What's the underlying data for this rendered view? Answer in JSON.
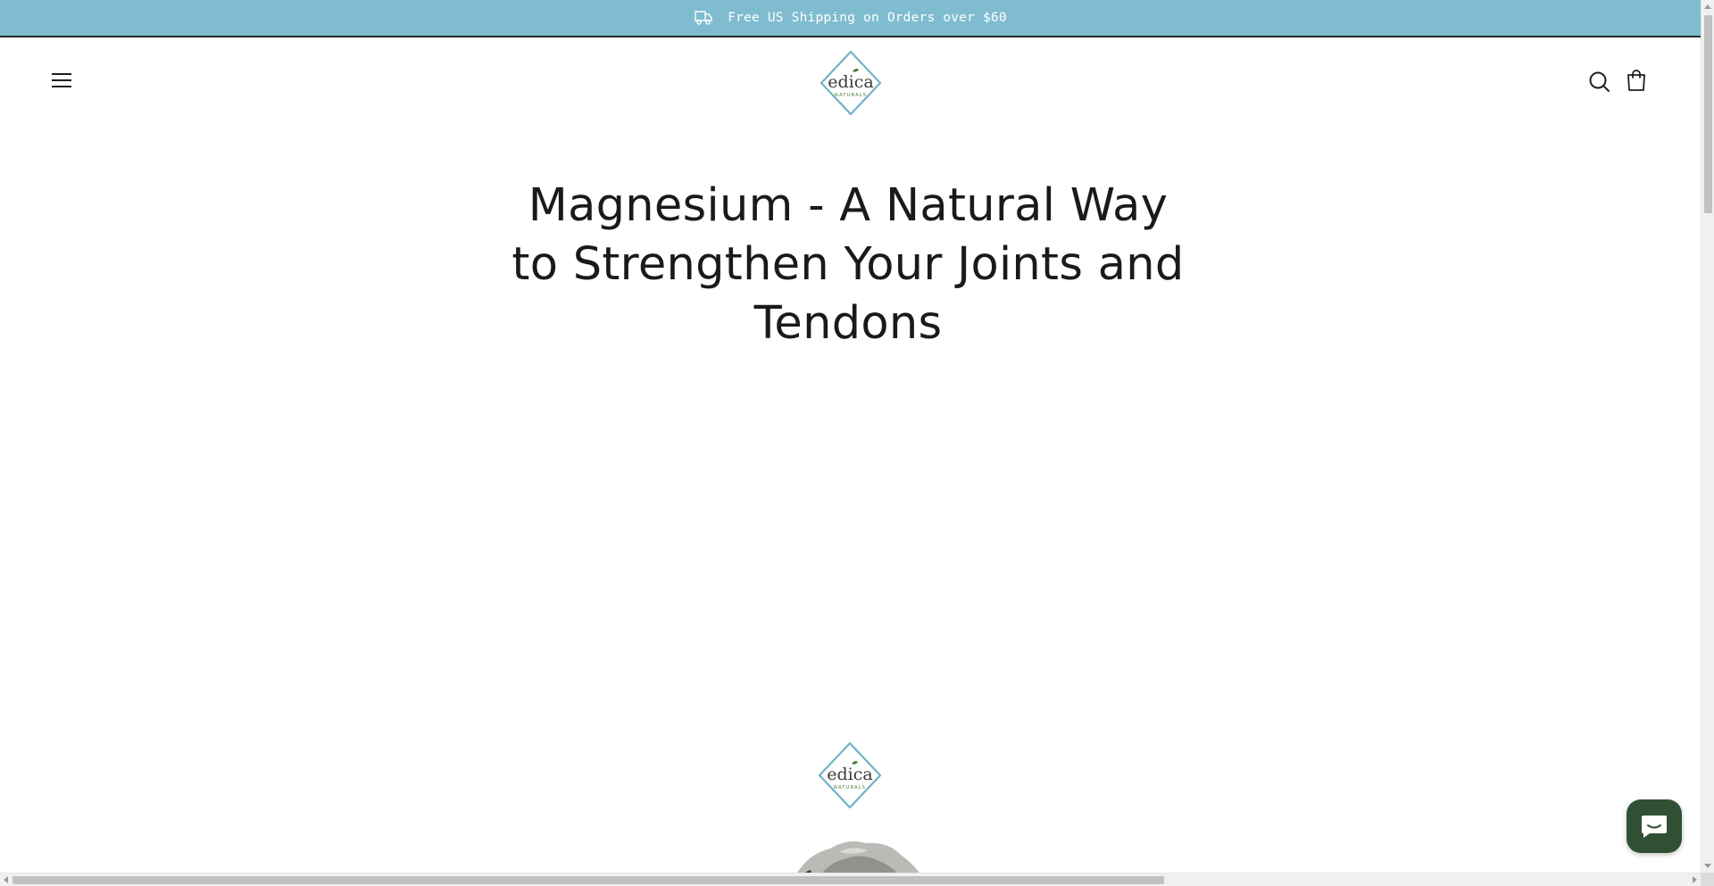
{
  "announcement": {
    "icon": "truck-icon",
    "text": "Free US Shipping on Orders over $60",
    "background": "#7fbccf"
  },
  "header": {
    "menu_icon": "hamburger-menu-icon",
    "logo": {
      "name": "edica",
      "tagline": "NATURALS"
    },
    "search_icon": "search-icon",
    "cart_icon": "shopping-bag-icon"
  },
  "article": {
    "title": "Magnesium - A Natural Way to Strengthen Your Joints and Tendons"
  },
  "featured_image": {
    "logo": {
      "name": "edica",
      "tagline": "NATURALS"
    }
  },
  "chat": {
    "icon": "chat-bubble-icon",
    "color": "#2f5032"
  },
  "colors": {
    "brand_teal": "#6fb3c8",
    "brand_green": "#4f7d3a",
    "text": "#1a1a1a"
  }
}
